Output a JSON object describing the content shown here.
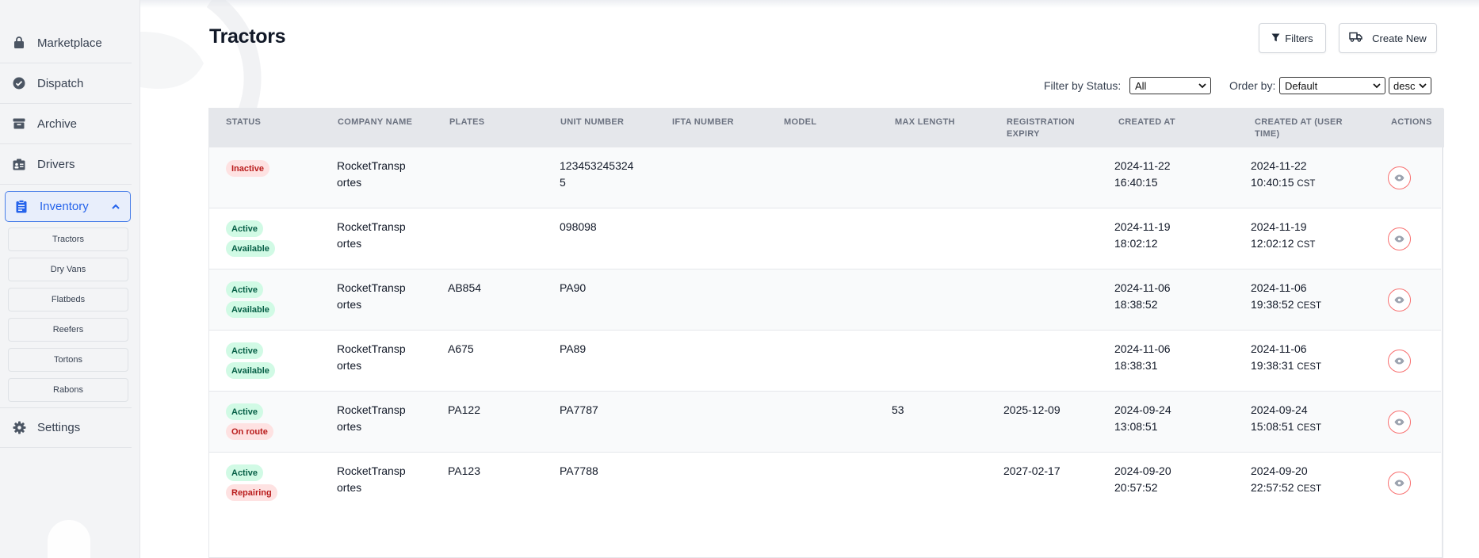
{
  "sidebar": {
    "items": [
      {
        "label": "Marketplace",
        "icon": "lock-bag-icon"
      },
      {
        "label": "Dispatch",
        "icon": "check-circle-icon"
      },
      {
        "label": "Archive",
        "icon": "archive-box-icon"
      },
      {
        "label": "Drivers",
        "icon": "id-card-icon"
      },
      {
        "label": "Inventory",
        "icon": "clipboard-icon"
      },
      {
        "label": "Settings",
        "icon": "gear-icon"
      }
    ],
    "inventory_sub": [
      "Tractors",
      "Dry Vans",
      "Flatbeds",
      "Reefers",
      "Tortons",
      "Rabons"
    ]
  },
  "header": {
    "title": "Tractors",
    "filters_label": "Filters",
    "create_label": "Create New"
  },
  "controls": {
    "status_label": "Filter by Status:",
    "status_value": "All",
    "order_label": "Order by:",
    "order_value": "Default",
    "dir_value": "desc"
  },
  "table": {
    "columns": [
      "STATUS",
      "COMPANY NAME",
      "PLATES",
      "UNIT NUMBER",
      "IFTA NUMBER",
      "MODEL",
      "MAX LENGTH",
      "REGISTRATION",
      "EXPIRY",
      "CREATED AT",
      "CREATED AT (USER",
      "TIME)",
      "ACTIONS"
    ],
    "rows": [
      {
        "badges": [
          "Inactive"
        ],
        "company": [
          "RocketTransp",
          "ortes"
        ],
        "plates": "",
        "unit": [
          "123453245324",
          "5"
        ],
        "max_length": "",
        "reg_expiry": "",
        "created": [
          "2024-11-22",
          "16:40:15"
        ],
        "user_date": "2024-11-22",
        "user_time": "10:40:15",
        "tz": "CST"
      },
      {
        "badges": [
          "Active",
          "Available"
        ],
        "company": [
          "RocketTransp",
          "ortes"
        ],
        "plates": "",
        "unit": [
          "098098",
          ""
        ],
        "max_length": "",
        "reg_expiry": "",
        "created": [
          "2024-11-19",
          "18:02:12"
        ],
        "user_date": "2024-11-19",
        "user_time": "12:02:12",
        "tz": "CST"
      },
      {
        "badges": [
          "Active",
          "Available"
        ],
        "company": [
          "RocketTransp",
          "ortes"
        ],
        "plates": "AB854",
        "unit": [
          "PA90",
          ""
        ],
        "max_length": "",
        "reg_expiry": "",
        "created": [
          "2024-11-06",
          "18:38:52"
        ],
        "user_date": "2024-11-06",
        "user_time": "19:38:52",
        "tz": "CEST"
      },
      {
        "badges": [
          "Active",
          "Available"
        ],
        "company": [
          "RocketTransp",
          "ortes"
        ],
        "plates": "A675",
        "unit": [
          "PA89",
          ""
        ],
        "max_length": "",
        "reg_expiry": "",
        "created": [
          "2024-11-06",
          "18:38:31"
        ],
        "user_date": "2024-11-06",
        "user_time": "19:38:31",
        "tz": "CEST"
      },
      {
        "badges": [
          "Active",
          "On route"
        ],
        "company": [
          "RocketTransp",
          "ortes"
        ],
        "plates": "PA122",
        "unit": [
          "PA7787",
          ""
        ],
        "max_length": "53",
        "reg_expiry": "2025-12-09",
        "created": [
          "2024-09-24",
          "13:08:51"
        ],
        "user_date": "2024-09-24",
        "user_time": "15:08:51",
        "tz": "CEST"
      },
      {
        "badges": [
          "Active",
          "Repairing"
        ],
        "company": [
          "RocketTransp",
          "ortes"
        ],
        "plates": "PA123",
        "unit": [
          "PA7788",
          ""
        ],
        "max_length": "",
        "reg_expiry": "2027-02-17",
        "created": [
          "2024-09-20",
          "20:57:52"
        ],
        "user_date": "2024-09-20",
        "user_time": "22:57:52",
        "tz": "CEST"
      }
    ]
  },
  "colors": {
    "accent": "#2563eb",
    "badge_green": "#d1fae5",
    "badge_red": "#fee2e2",
    "view_border": "#f87171"
  }
}
